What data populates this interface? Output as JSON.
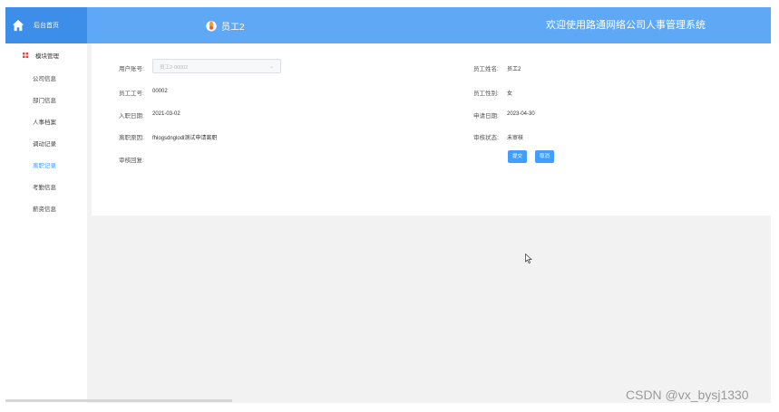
{
  "header": {
    "home_label": "后台首页",
    "user_name": "员工2",
    "system_title": "欢迎使用路通网络公司人事管理系统"
  },
  "sidebar": {
    "group_label": "模块管理",
    "items": [
      {
        "label": "公司信息"
      },
      {
        "label": "部门信息"
      },
      {
        "label": "人事档案"
      },
      {
        "label": "调动记录"
      },
      {
        "label": "离职记录"
      },
      {
        "label": "考勤信息"
      },
      {
        "label": "薪资信息"
      }
    ],
    "active_index": 4
  },
  "form": {
    "account_label": "用户账号:",
    "account_value": "员工2-00002",
    "name_label": "员工姓名:",
    "name_value": "员工2",
    "id_label": "员工工号:",
    "id_value": "00002",
    "gender_label": "员工性别:",
    "gender_value": "女",
    "join_label": "入职日期:",
    "join_value": "2021-03-02",
    "apply_label": "申请日期:",
    "apply_value": "2023-04-30",
    "reason_label": "离职原因:",
    "reason_value": "fhlogsdnglodl测试申请离职",
    "status_label": "审核状态:",
    "status_value": "未审核",
    "reply_label": "审核回复:",
    "submit_label": "提交",
    "cancel_label": "取消"
  },
  "watermark": "CSDN @vx_bysj1330",
  "colors": {
    "header": "#5fa8f5",
    "home_block": "#3d8ee8",
    "button": "#409eff",
    "active_menu": "#4a9df5"
  }
}
